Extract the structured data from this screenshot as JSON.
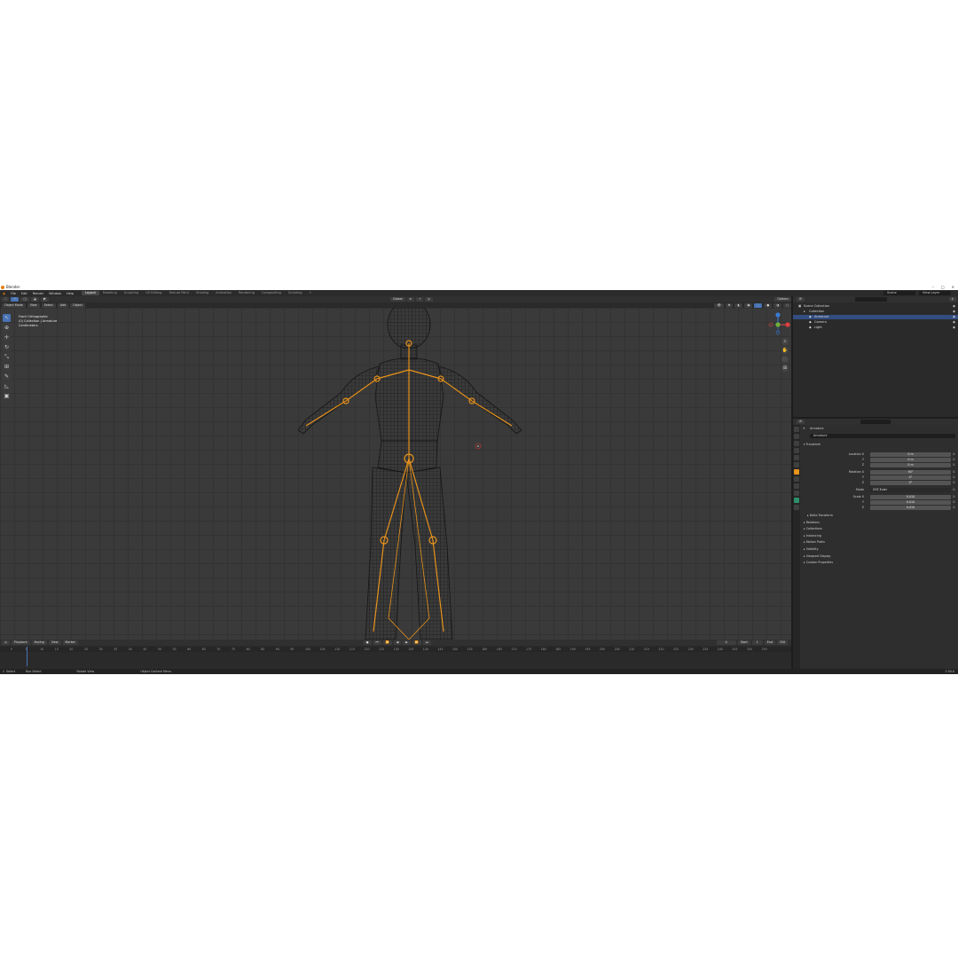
{
  "window": {
    "title": "Blender",
    "controls": [
      "–",
      "□",
      "✕"
    ]
  },
  "menu": {
    "items": [
      "File",
      "Edit",
      "Render",
      "Window",
      "Help"
    ],
    "workspaces": [
      "Layout",
      "Modeling",
      "Sculpting",
      "UV Editing",
      "Texture Paint",
      "Shading",
      "Animation",
      "Rendering",
      "Compositing",
      "Scripting",
      "+"
    ],
    "scene": "Scene",
    "view_layer": "View Layer"
  },
  "viewport": {
    "mode": "Object Mode",
    "menus": [
      "View",
      "Select",
      "Add",
      "Object"
    ],
    "orientation": "Global",
    "options": "Options",
    "overlay_lines": [
      "Front Orthographic",
      "(0) Collection | Armature",
      "Centimeters"
    ]
  },
  "tools": [
    "select-box",
    "cursor",
    "move",
    "rotate",
    "scale",
    "transform",
    "annotate",
    "measure",
    "add-cube"
  ],
  "timeline": {
    "menus": [
      "Playback",
      "Keying",
      "View",
      "Marker"
    ],
    "current_frame": "0",
    "start_label": "Start",
    "start": "1",
    "end_label": "End",
    "end": "250",
    "ticks": [
      "0",
      "5",
      "10",
      "15",
      "20",
      "25",
      "30",
      "35",
      "40",
      "45",
      "50",
      "55",
      "60",
      "65",
      "70",
      "75",
      "80",
      "85",
      "90",
      "95",
      "100",
      "105",
      "110",
      "115",
      "120",
      "125",
      "130",
      "135",
      "140",
      "145",
      "150",
      "155",
      "160",
      "165",
      "170",
      "175",
      "180",
      "185",
      "190",
      "195",
      "200",
      "205",
      "210",
      "215",
      "220",
      "225",
      "230",
      "235",
      "240",
      "245",
      "250",
      "255"
    ]
  },
  "status": {
    "select": "Select",
    "box_select": "Box Select",
    "rotate_view": "Rotate View",
    "context_menu": "Object Context Menu",
    "version": "2.90.0"
  },
  "outliner": {
    "rows": [
      {
        "label": "Scene Collection",
        "indent": 0,
        "selected": false
      },
      {
        "label": "Collection",
        "indent": 1,
        "selected": false
      },
      {
        "label": "Armature",
        "indent": 2,
        "selected": true
      },
      {
        "label": "Camera",
        "indent": 2,
        "selected": false
      },
      {
        "label": "Light",
        "indent": 2,
        "selected": false
      }
    ]
  },
  "properties": {
    "object_name": "Armature",
    "data_name": "Armature",
    "transform_title": "Transform",
    "fields": [
      {
        "label": "Location X",
        "value": "0 m"
      },
      {
        "label": "Y",
        "value": "0 m"
      },
      {
        "label": "Z",
        "value": "0 m"
      },
      {
        "label": "Rotation X",
        "value": "90°"
      },
      {
        "label": "Y",
        "value": "0°"
      },
      {
        "label": "Z",
        "value": "0°"
      },
      {
        "label": "Mode",
        "value": "XYZ Euler"
      },
      {
        "label": "Scale X",
        "value": "0.010"
      },
      {
        "label": "Y",
        "value": "0.010"
      },
      {
        "label": "Z",
        "value": "0.010"
      }
    ],
    "sections": [
      "Delta Transform",
      "Relations",
      "Collections",
      "Instancing",
      "Motion Paths",
      "Visibility",
      "Viewport Display",
      "Custom Properties"
    ]
  },
  "colors": {
    "accent": "#4772b3",
    "wire": "#1a1a1a",
    "bones": "#e8931c",
    "selection": "#334d80"
  }
}
